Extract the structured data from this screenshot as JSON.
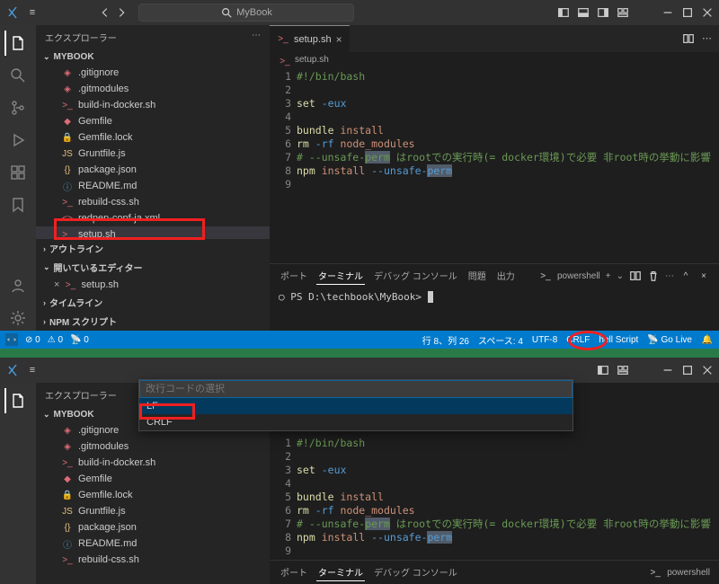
{
  "titlebar": {
    "menu": "≡",
    "search": "MyBook"
  },
  "explorer": {
    "title": "エクスプローラー",
    "project": "MYBOOK"
  },
  "files": [
    {
      "name": ".gitignore",
      "icon": "git"
    },
    {
      "name": ".gitmodules",
      "icon": "git"
    },
    {
      "name": "build-in-docker.sh",
      "icon": "sh"
    },
    {
      "name": "Gemfile",
      "icon": "gem"
    },
    {
      "name": "Gemfile.lock",
      "icon": "lock"
    },
    {
      "name": "Gruntfile.js",
      "icon": "js"
    },
    {
      "name": "package.json",
      "icon": "json"
    },
    {
      "name": "README.md",
      "icon": "md"
    },
    {
      "name": "rebuild-css.sh",
      "icon": "sh"
    },
    {
      "name": "redpen-conf-ja.xml",
      "icon": "xml"
    },
    {
      "name": "setup.sh",
      "icon": "sh"
    }
  ],
  "sections": {
    "outline": "アウトライン",
    "openEditors": "開いているエディター",
    "timeline": "タイムライン",
    "npm": "NPM スクリプト",
    "openFile": "setup.sh"
  },
  "tab": {
    "name": "setup.sh"
  },
  "breadcrumb": "setup.sh",
  "code": {
    "lines": [
      "1",
      "2",
      "3",
      "4",
      "5",
      "6",
      "7",
      "8",
      "9"
    ],
    "l1": "#!/bin/bash",
    "l3a": "set",
    "l3b": "-eux",
    "l5a": "bundle",
    "l5b": "install",
    "l6a": "rm",
    "l6b": "-rf",
    "l6c": "node_modules",
    "l7": "# --unsafe-perm はrootでの実行時(= docker環境)で必要 非root時の挙動に影響",
    "l7hl": "perm",
    "l8a": "npm",
    "l8b": "install",
    "l8c": "--unsafe-",
    "l8d": "perm"
  },
  "panel": {
    "ports": "ポート",
    "terminal": "ターミナル",
    "debug": "デバッグ コンソール",
    "problems": "問題",
    "output": "出力",
    "shell": "powershell",
    "prompt": "PS D:\\techbook\\MyBook>"
  },
  "status": {
    "errors": "0",
    "warnings": "0",
    "port": "0",
    "pos": "行 8、列 26",
    "spaces": "スペース: 4",
    "enc": "UTF-8",
    "eol": "CRLF",
    "lang": "hell Script",
    "golive": "Go Live"
  },
  "picker": {
    "title": "改行コードの選択",
    "opt1": "LF",
    "opt2": "CRLF"
  }
}
